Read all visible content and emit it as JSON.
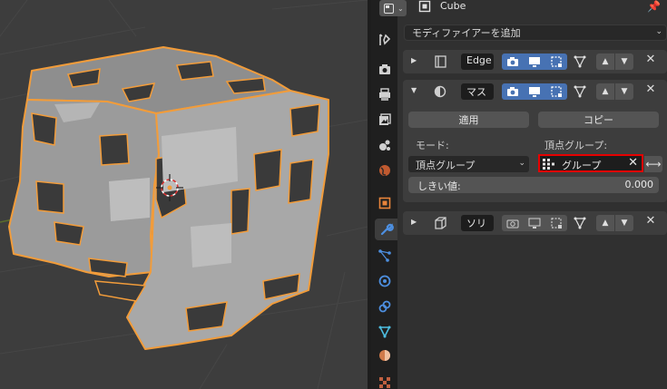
{
  "header": {
    "object_name": "Cube",
    "editor_type_icon": "properties-editor-icon",
    "pin_icon": "pin-icon"
  },
  "add_modifier": {
    "label": "モディファイアーを追加"
  },
  "tabs": [
    {
      "name": "tool-tab",
      "icon": "tool-icon"
    },
    {
      "name": "render-tab",
      "icon": "render-icon"
    },
    {
      "name": "output-tab",
      "icon": "output-icon"
    },
    {
      "name": "view-layer-tab",
      "icon": "view-layer-icon"
    },
    {
      "name": "scene-tab",
      "icon": "scene-icon"
    },
    {
      "name": "world-tab",
      "icon": "world-icon"
    },
    {
      "name": "object-tab",
      "icon": "object-icon"
    },
    {
      "name": "modifier-tab",
      "icon": "wrench-icon",
      "active": true
    },
    {
      "name": "particles-tab",
      "icon": "particles-icon"
    },
    {
      "name": "physics-tab",
      "icon": "physics-icon"
    },
    {
      "name": "constraints-tab",
      "icon": "constraints-icon"
    },
    {
      "name": "data-tab",
      "icon": "mesh-data-icon"
    },
    {
      "name": "material-tab",
      "icon": "material-icon"
    },
    {
      "name": "texture-tab",
      "icon": "texture-icon"
    }
  ],
  "modifiers": [
    {
      "name": "Edge",
      "expanded": false,
      "type_icon": "edge-split-icon"
    },
    {
      "name": "マス",
      "expanded": true,
      "type_icon": "mask-icon",
      "apply_label": "適用",
      "copy_label": "コピー",
      "mode_label": "モード:",
      "mode_value": "頂点グループ",
      "vertex_group_label": "頂点グループ:",
      "vertex_group_value": "グループ",
      "invert_icon": "invert-arrows-icon",
      "threshold_label": "しきい値:",
      "threshold_value": "0.000"
    },
    {
      "name": "ソリ",
      "expanded": false,
      "type_icon": "solidify-icon"
    }
  ],
  "colors": {
    "selection_outline": "#f29c3a",
    "highlight_box": "#e60000",
    "toggle_active": "#4772b3"
  }
}
